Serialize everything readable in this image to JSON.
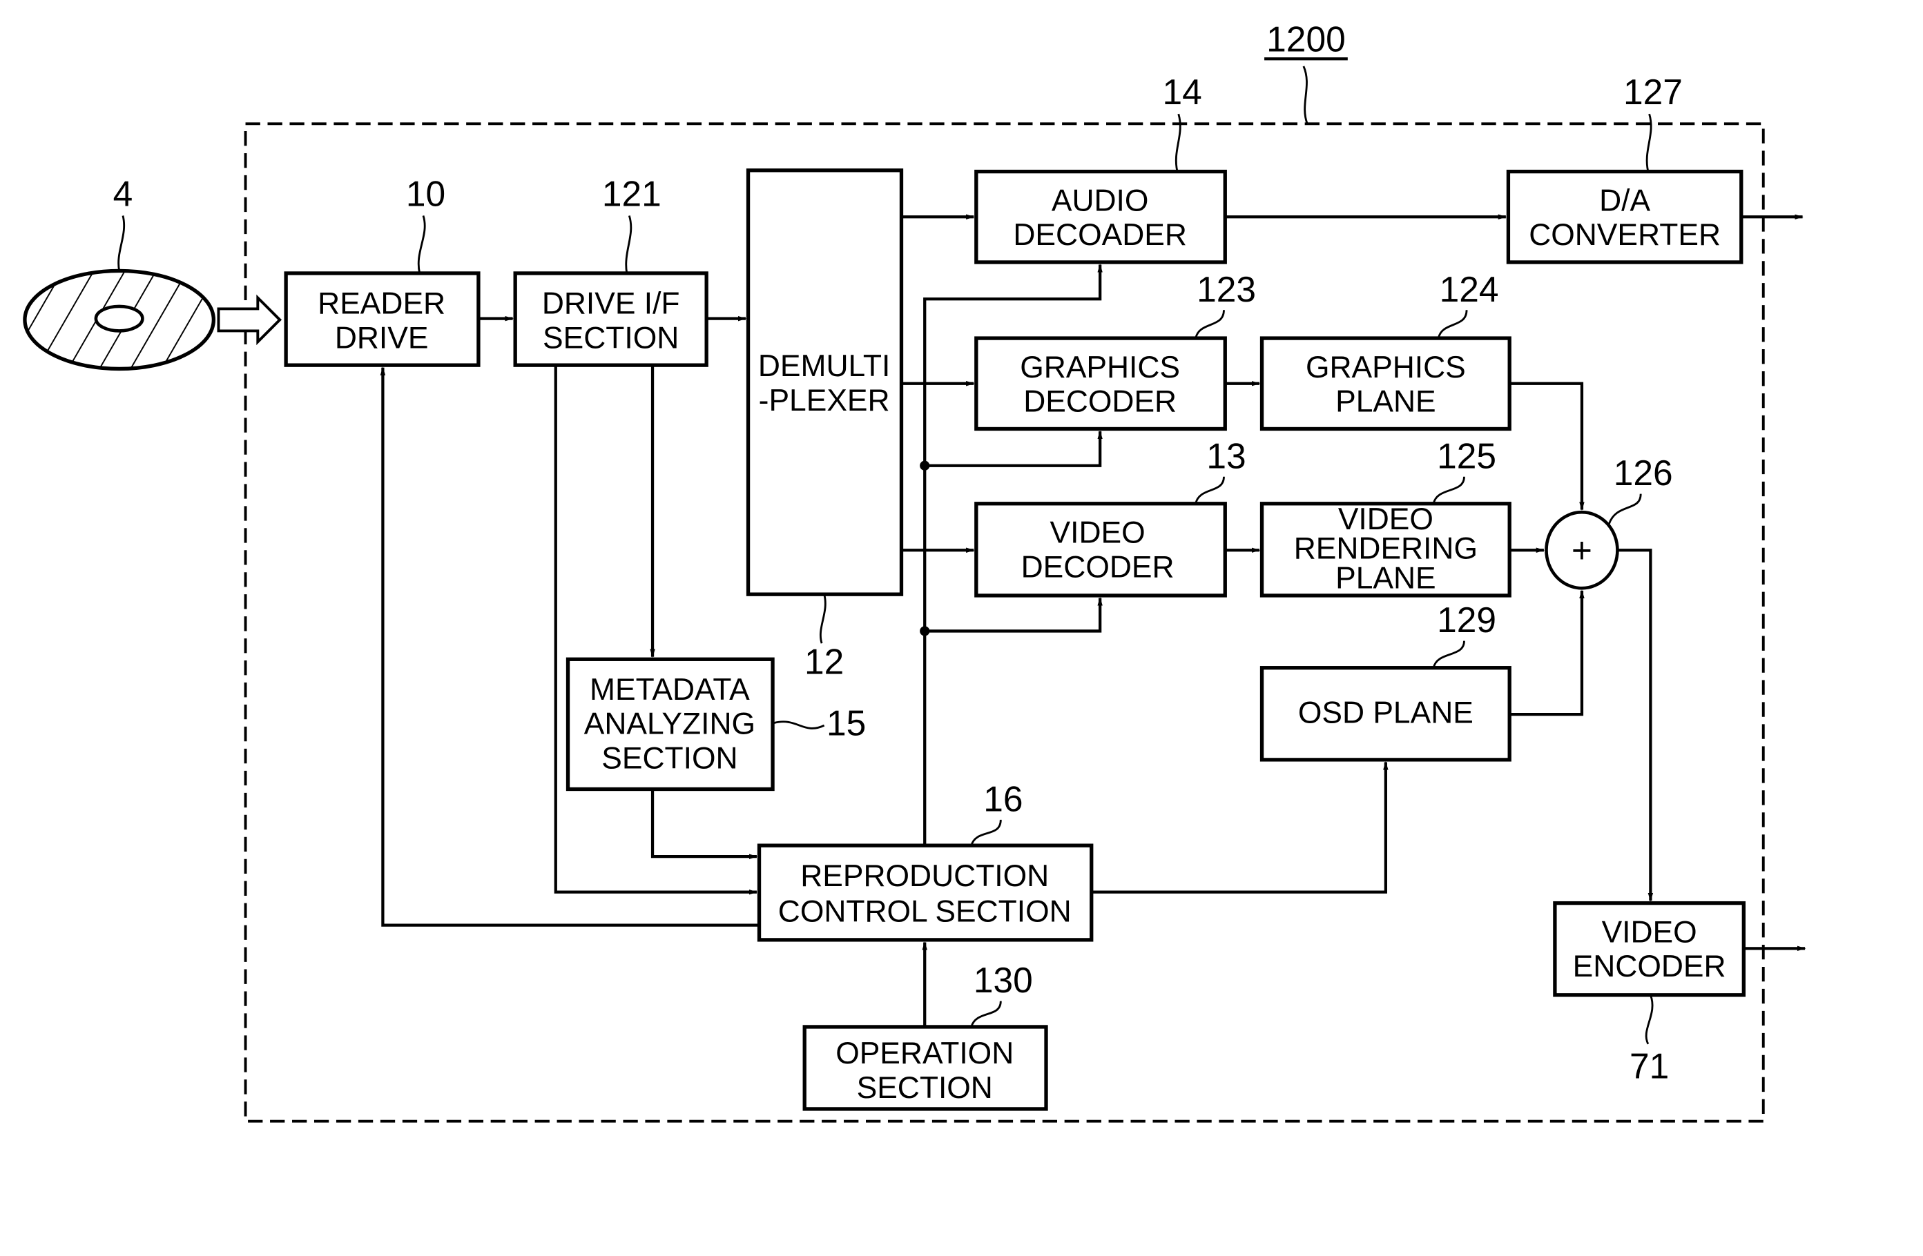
{
  "figure": {
    "system_ref": "1200",
    "disc_ref": "4",
    "blocks": {
      "reader_drive": {
        "ref": "10",
        "lines": [
          "READER",
          "DRIVE"
        ]
      },
      "drive_if": {
        "ref": "121",
        "lines": [
          "DRIVE I/F",
          "SECTION"
        ]
      },
      "demux": {
        "ref": "12",
        "lines": [
          "DEMULTI",
          "-PLEXER"
        ]
      },
      "audio_decoder": {
        "ref": "14",
        "lines": [
          "AUDIO",
          "DECOADER"
        ]
      },
      "da_converter": {
        "ref": "127",
        "lines": [
          "D/A",
          "CONVERTER"
        ]
      },
      "graphics_decoder": {
        "ref": "123",
        "lines": [
          "GRAPHICS",
          "DECODER"
        ]
      },
      "graphics_plane": {
        "ref": "124",
        "lines": [
          "GRAPHICS",
          "PLANE"
        ]
      },
      "video_decoder": {
        "ref": "13",
        "lines": [
          "VIDEO",
          "DECODER"
        ]
      },
      "video_rendering_plane": {
        "ref": "125",
        "lines": [
          "VIDEO",
          "RENDERING",
          "PLANE"
        ]
      },
      "adder": {
        "ref": "126",
        "symbol": "+"
      },
      "osd_plane": {
        "ref": "129",
        "lines": [
          "OSD PLANE"
        ]
      },
      "metadata": {
        "ref": "15",
        "lines": [
          "METADATA",
          "ANALYZING",
          "SECTION"
        ]
      },
      "reproduction_control": {
        "ref": "16",
        "lines": [
          "REPRODUCTION",
          "CONTROL SECTION"
        ]
      },
      "operation": {
        "ref": "130",
        "lines": [
          "OPERATION",
          "SECTION"
        ]
      },
      "video_encoder": {
        "ref": "71",
        "lines": [
          "VIDEO",
          "ENCODER"
        ]
      }
    }
  }
}
